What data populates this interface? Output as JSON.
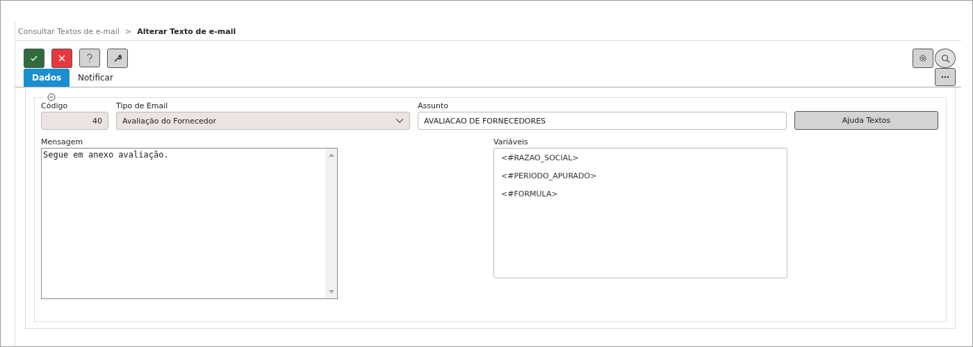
{
  "breadcrumb": [
    {
      "label": "Consultar Textos de e-mail",
      "current": false
    },
    {
      "label": "Alterar Texto de e-mail",
      "current": true
    }
  ],
  "breadcrumb_separator": ">",
  "toolbar": [
    {
      "kind": "confirm"
    },
    {
      "kind": "cancel"
    },
    {
      "kind": "help"
    },
    {
      "kind": "tools"
    }
  ],
  "toolbar_right": [
    {
      "kind": "settings"
    },
    {
      "kind": "search"
    }
  ],
  "tabs": [
    {
      "label": "Dados",
      "selected": true
    },
    {
      "label": "Notificar",
      "selected": false
    }
  ],
  "form": {
    "codigo": {
      "label": "Código",
      "value": "40",
      "disabled": true
    },
    "tipo": {
      "label": "Tipo de Email",
      "value": "Avaliação do Fornecedor",
      "disabled": true
    },
    "assunto": {
      "label": "Assunto",
      "value": "AVALIACAO DE FORNECEDORES",
      "disabled": false
    },
    "help_button": "Ajuda Textos",
    "mensagem": {
      "label": "Mensagem",
      "value": "Segue em anexo avaliação."
    },
    "variaveis": {
      "label": "Variáveis",
      "items": [
        "<#RAZAO_SOCIAL>",
        "<#PERIODO_APURADO>",
        "<#FORMULA>"
      ]
    }
  }
}
